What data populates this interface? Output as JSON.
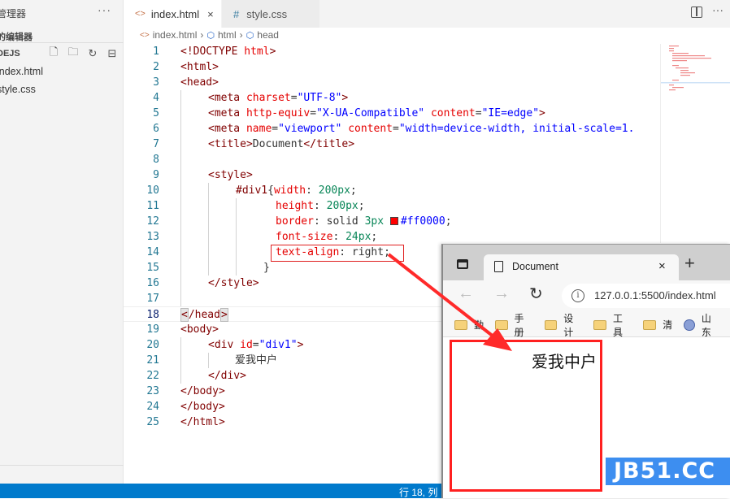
{
  "sidebar": {
    "title": "管理器",
    "more": "···",
    "open_editors": "的编辑器",
    "project": "DEJS",
    "actions": [
      "new-file-icon",
      "new-folder-icon",
      "refresh-icon",
      "collapse-icon"
    ],
    "files": [
      {
        "name": "index.html"
      },
      {
        "name": "style.css"
      }
    ]
  },
  "tabs": [
    {
      "label": "index.html",
      "icon": "<>",
      "close": "×",
      "active": true
    },
    {
      "label": "style.css",
      "icon": "#",
      "active": false
    }
  ],
  "toolbar": {
    "more": "···"
  },
  "breadcrumb": [
    "index.html",
    "html",
    "head"
  ],
  "editor": {
    "current_line": 18,
    "lines": [
      {
        "n": "1"
      },
      {
        "n": "2"
      },
      {
        "n": "3"
      },
      {
        "n": "4"
      },
      {
        "n": "5"
      },
      {
        "n": "6"
      },
      {
        "n": "7"
      },
      {
        "n": "8"
      },
      {
        "n": "9"
      },
      {
        "n": "10"
      },
      {
        "n": "11"
      },
      {
        "n": "12"
      },
      {
        "n": "13"
      },
      {
        "n": "14"
      },
      {
        "n": "15"
      },
      {
        "n": "16"
      },
      {
        "n": "17"
      },
      {
        "n": "18"
      },
      {
        "n": "19"
      },
      {
        "n": "20"
      },
      {
        "n": "21"
      },
      {
        "n": "22"
      },
      {
        "n": "23"
      },
      {
        "n": "24"
      },
      {
        "n": "25"
      }
    ],
    "tokens": {
      "l1a": "<!DOCTYPE ",
      "l1b": "html",
      "l1c": ">",
      "l2": "<html>",
      "l3": "<head>",
      "l4a": "<meta ",
      "l4b": "charset",
      "l4c": "=",
      "l4d": "\"UTF-8\"",
      "l4e": ">",
      "l5a": "<meta ",
      "l5b": "http-equiv",
      "l5c": "=",
      "l5d": "\"X-UA-Compatible\"",
      "l5e": " ",
      "l5f": "content",
      "l5g": "=",
      "l5h": "\"IE=edge\"",
      "l5i": ">",
      "l6a": "<meta ",
      "l6b": "name",
      "l6c": "=",
      "l6d": "\"viewport\"",
      "l6e": " ",
      "l6f": "content",
      "l6g": "=",
      "l6h": "\"width=device-width, initial-scale=1.",
      "l7a": "<title>",
      "l7b": "Document",
      "l7c": "</title>",
      "l9": "<style>",
      "l10a": "#div1",
      "l10b": "{",
      "l10c": "width",
      "l10d": ": ",
      "l10e": "200px",
      ";": ";",
      "l11a": "height",
      "l11b": ": ",
      "l11c": "200px",
      "l11d": ";",
      "l12a": "border",
      "l12b": ": solid ",
      "l12c": "3px",
      "l12d": " ",
      "l12e": "#ff0000",
      "l12f": ";",
      "l13a": "font-size",
      "l13b": ": ",
      "l13c": "24px",
      "l13d": ";",
      "l14a": "text-align",
      "l14b": ": right;",
      "l15": "}",
      "l16": "</style>",
      "l18a": "<",
      "l18b": "/head",
      "l18c": ">",
      "l19": "<body>",
      "l20a": "<div ",
      "l20b": "id",
      "l20c": "=",
      "l20d": "\"div1\"",
      "l20e": ">",
      "l21": "爱我中户",
      "l22": "</div>",
      "l23": "</body>",
      "l24": "</body>",
      "l25": "</html>"
    }
  },
  "status": {
    "position": "行 18, 列"
  },
  "browser": {
    "tab_title": "Document",
    "tab_close": "×",
    "new_tab": "+",
    "back": "←",
    "forward": "→",
    "reload": "C",
    "info": "i",
    "url": "127.0.0.1:5500/index.html",
    "bookmarks": [
      {
        "label": "勤",
        "icon": "folder-icon"
      },
      {
        "label": "手册",
        "icon": "folder-icon"
      },
      {
        "label": "设计",
        "icon": "folder-icon"
      },
      {
        "label": "工具",
        "icon": "folder-icon"
      },
      {
        "label": "清",
        "icon": "folder-icon"
      },
      {
        "label": "山东",
        "icon": "globe-icon"
      }
    ],
    "page_text": "爱我中户"
  },
  "colors": {
    "accent": "#007acc",
    "annotation": "#ff2020",
    "css_color_swatch": "#ff0000",
    "watermark_bg": "#3d8ef0"
  },
  "watermark": "JB51.CC"
}
